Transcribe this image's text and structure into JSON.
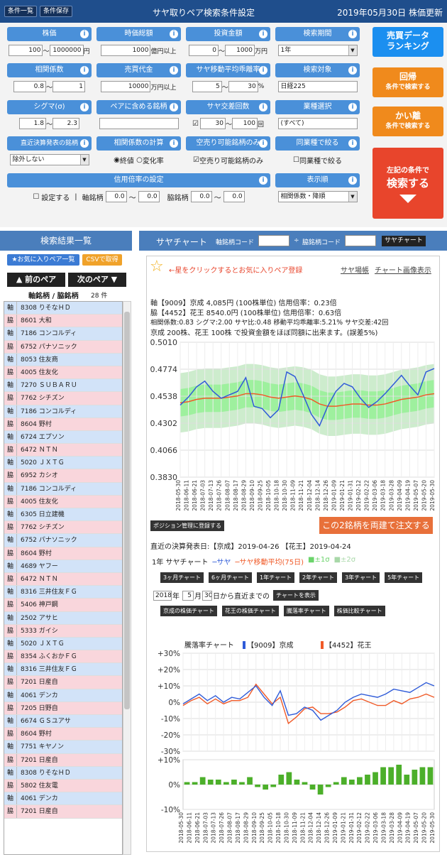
{
  "top": {
    "btn_list": "条件一覧",
    "btn_save": "条件保存",
    "title": "サヤ取りペア検索条件設定",
    "date": "2019年05月30日 株価更新"
  },
  "cond": {
    "kabuka": {
      "label": "株価",
      "v1": "100",
      "v2": "1000000",
      "unit": "円"
    },
    "jika": {
      "label": "時価総額",
      "v1": "1000",
      "unit": "億円以上"
    },
    "toushi": {
      "label": "投資金額",
      "v1": "0",
      "v2": "1000",
      "unit": "万円"
    },
    "kikan": {
      "label": "検索期間",
      "value": "1年"
    },
    "soukan": {
      "label": "相関係数",
      "v1": "0.8",
      "v2": "1"
    },
    "baibai": {
      "label": "売買代金",
      "v1": "10000",
      "unit": "万円以上"
    },
    "kairi": {
      "label": "サヤ移動平均乖離率",
      "v1": "5",
      "v2": "30",
      "unit": "%"
    },
    "taisho": {
      "label": "検索対象",
      "value": "日経225"
    },
    "sigma": {
      "label": "シグマ(σ)",
      "v1": "1.8",
      "v2": "2.3"
    },
    "pair_inc": {
      "label": "ペアに含める銘柄",
      "value": ""
    },
    "kosa": {
      "label": "サヤ交差回数",
      "v1": "30",
      "v2": "100",
      "unit": "回"
    },
    "gyoshu": {
      "label": "業種選択",
      "value": "(すべて)"
    },
    "kessan": {
      "label": "直近決算発表の銘柄",
      "value": "除外しない"
    },
    "calc": {
      "label": "相関係数の計算",
      "opt1": "終値",
      "opt2": "変化率"
    },
    "karauri": {
      "label": "空売り可能銘柄のみ",
      "check": "空売り可能銘柄のみ"
    },
    "dougyo": {
      "label": "同業種で絞る",
      "check": "同業種で絞る"
    },
    "shinyo": {
      "label": "信用倍率の設定",
      "set": "設定する",
      "sep": "|",
      "jiku": "軸銘柄",
      "v1": "0.0",
      "v2": "0.0",
      "waki": "脇銘柄",
      "v3": "0.0",
      "v4": "0.0"
    },
    "order": {
      "label": "表示順",
      "value": "相関係数・降順"
    },
    "tilde": "〜"
  },
  "btns": {
    "rank1": "売買データ",
    "rank2": "ランキング",
    "kaiki1": "回帰",
    "kaiki2": "条件で検索する",
    "kairi1": "かい離",
    "kairi2": "条件で検索する",
    "search1": "左記の条件で",
    "search2": "検索する"
  },
  "left": {
    "title": "検索結果一覧",
    "fav": "★お気に入りペア一覧",
    "csv": "CSVで取得",
    "prev": "▲ 前のペア",
    "next": "次のペア ▼",
    "subtitle": "軸銘柄 / 脇銘柄",
    "count": "28 件"
  },
  "pairs": [
    [
      "8308 りそなＨＤ",
      "8601 大和"
    ],
    [
      "7186 コンコルディ",
      "6752 パナソニック"
    ],
    [
      "8053 住友商",
      "4005 住友化"
    ],
    [
      "7270 ＳＵＢＡＲＵ",
      "7762 シチズン"
    ],
    [
      "7186 コンコルディ",
      "8604 野村"
    ],
    [
      "6724 エプソン",
      "6472 ＮＴＮ"
    ],
    [
      "5020 ＪＸＴＧ",
      "6952 カシオ"
    ],
    [
      "7186 コンコルディ",
      "4005 住友化"
    ],
    [
      "6305 日立建機",
      "7762 シチズン"
    ],
    [
      "6752 パナソニック",
      "8604 野村"
    ],
    [
      "4689 ヤフー",
      "6472 ＮＴＮ"
    ],
    [
      "8316 三井住友ＦＧ",
      "5406 神戸鋼"
    ],
    [
      "2502 アサヒ",
      "5333 ガイシ"
    ],
    [
      "5020 ＪＸＴＧ",
      "8354 ふくおかＦＧ"
    ],
    [
      "8316 三井住友ＦＧ",
      "7201 日産自"
    ],
    [
      "4061 デンカ",
      "7205 日野自"
    ],
    [
      "6674 ＧＳユアサ",
      "8604 野村"
    ],
    [
      "7751 キヤノン",
      "7201 日産自"
    ],
    [
      "8308 りそなＨＤ",
      "5802 住友電"
    ],
    [
      "4061 デンカ",
      "7201 日産自"
    ]
  ],
  "tags": {
    "jiku": "軸",
    "waki": "脇"
  },
  "right": {
    "title": "サヤチャート",
    "code1": "軸銘柄コード",
    "div": "÷",
    "code2": "脇銘柄コード",
    "btn": "サヤチャート"
  },
  "chart": {
    "star_text": "←星をクリックするとお気に入りペア登録",
    "link1": "サヤ場帳",
    "link2": "チャート画像表示",
    "info1": "軸【9009】京成 4,085円 (100株単位) 信用倍率：0.23倍",
    "info2": "脇【4452】花王 8540.0円 (100株単位) 信用倍率：0.63倍",
    "info3": "相関係数:0.83  シグマ:2.00  サヤ比:0.48  移動平均乖離率:5.21%  サヤ交差:42回",
    "info4": "京成 200株、花王 100株 で投資金額をほぼ同額に出来ます。(誤差5%)",
    "pos_btn": "ポジション管理に登録する",
    "order_btn": "この2銘柄を両建て注文する",
    "kessan": "直近の決算発表日:【京成】2019-04-26 【花王】2019-04-24",
    "legend_title": "1年 サヤチャート",
    "leg1": "─サヤ",
    "leg2": "─サヤ移動平均(75日)",
    "leg3": "■±1σ",
    "leg4": "■±2σ",
    "periods": [
      "3ヶ月チャート",
      "6ヶ月チャート",
      "1年チャート",
      "2年チャート",
      "3年チャート",
      "5年チャート"
    ],
    "from_year": "2018",
    "from_month": "5",
    "from_day": "30",
    "y_suffix": "年",
    "m_suffix": "月",
    "from_text": "日から直近までの",
    "show_btn": "チャートを表示",
    "sub_btns": [
      "京成の株価チャート",
      "花王の株価チャート",
      "騰落率チャート",
      "株価比較チャート"
    ],
    "ratio_title": "騰落率チャート",
    "ratio_leg1": "【9009】京成",
    "ratio_leg2": "【4452】花王",
    "colors": {
      "saya": "#2f5bd8",
      "ma": "#f05a28",
      "s1": "#9ef09e",
      "s2": "#cdeccd",
      "bar": "#4caf2a"
    }
  },
  "chart_data": [
    {
      "type": "line",
      "title": "",
      "yticks": [
        "0.5010",
        "0.4774",
        "0.4538",
        "0.4302",
        "0.4066",
        "0.3830"
      ],
      "ylim": [
        0.383,
        0.501
      ],
      "x": [
        "2018-05-30",
        "2018-06-11",
        "2018-06-21",
        "2018-07-03",
        "2018-07-13",
        "2018-07-26",
        "2018-08-07",
        "2018-08-17",
        "2018-08-29",
        "2018-09-10",
        "2018-09-25",
        "2018-10-05",
        "2018-10-18",
        "2018-10-30",
        "2018-11-09",
        "2018-11-21",
        "2018-12-04",
        "2018-12-14",
        "2018-12-26",
        "2019-01-09",
        "2019-01-21",
        "2019-01-31",
        "2019-02-12",
        "2019-02-22",
        "2019-03-06",
        "2019-03-18",
        "2019-03-28",
        "2019-04-09",
        "2019-04-19",
        "2019-05-07",
        "2019-05-20",
        "2019-05-30"
      ],
      "series": [
        {
          "name": "サヤ",
          "values": [
            0.446,
            0.453,
            0.462,
            0.467,
            0.458,
            0.452,
            0.455,
            0.458,
            0.47,
            0.445,
            0.443,
            0.435,
            0.442,
            0.475,
            0.471,
            0.455,
            0.438,
            0.428,
            0.445,
            0.458,
            0.465,
            0.462,
            0.452,
            0.444,
            0.449,
            0.456,
            0.464,
            0.472,
            0.463,
            0.455,
            0.475,
            0.478
          ]
        },
        {
          "name": "サヤ移動平均(75日)",
          "values": [
            0.448,
            0.449,
            0.451,
            0.452,
            0.452,
            0.452,
            0.453,
            0.454,
            0.456,
            0.456,
            0.455,
            0.453,
            0.452,
            0.453,
            0.454,
            0.453,
            0.451,
            0.447,
            0.445,
            0.445,
            0.446,
            0.447,
            0.447,
            0.446,
            0.446,
            0.447,
            0.449,
            0.451,
            0.452,
            0.453,
            0.455,
            0.456
          ]
        }
      ]
    },
    {
      "type": "line",
      "title": "騰落率チャート",
      "ylim": [
        -30,
        30
      ],
      "yticks": [
        "+30%",
        "+20%",
        "+10%",
        "0%",
        "-10%",
        "-20%",
        "-30%"
      ],
      "series": [
        {
          "name": "【9009】京成",
          "values": [
            -1,
            2,
            5,
            1,
            4,
            0,
            3,
            2,
            6,
            10,
            3,
            -2,
            7,
            -8,
            -7,
            -3,
            -5,
            -11,
            -8,
            -5,
            0,
            3,
            5,
            4,
            3,
            5,
            8,
            7,
            6,
            9,
            12,
            10
          ]
        },
        {
          "name": "【4452】花王",
          "values": [
            -2,
            1,
            3,
            -1,
            2,
            -1,
            1,
            1,
            3,
            11,
            5,
            -1,
            3,
            -13,
            -9,
            -4,
            -3,
            -7,
            -7,
            -6,
            -3,
            1,
            2,
            0,
            -2,
            -2,
            1,
            -1,
            2,
            3,
            5,
            3
          ]
        }
      ]
    },
    {
      "type": "bar",
      "ylim": [
        -10,
        10
      ],
      "yticks": [
        "+10%",
        "0%",
        "-10%"
      ],
      "values": [
        1,
        1,
        3,
        2,
        2,
        1,
        2,
        1,
        3,
        -1,
        -2,
        -1,
        4,
        5,
        2,
        1,
        -2,
        -4,
        -1,
        1,
        3,
        2,
        3,
        4,
        5,
        7,
        7,
        8,
        4,
        6,
        7,
        7
      ]
    }
  ]
}
